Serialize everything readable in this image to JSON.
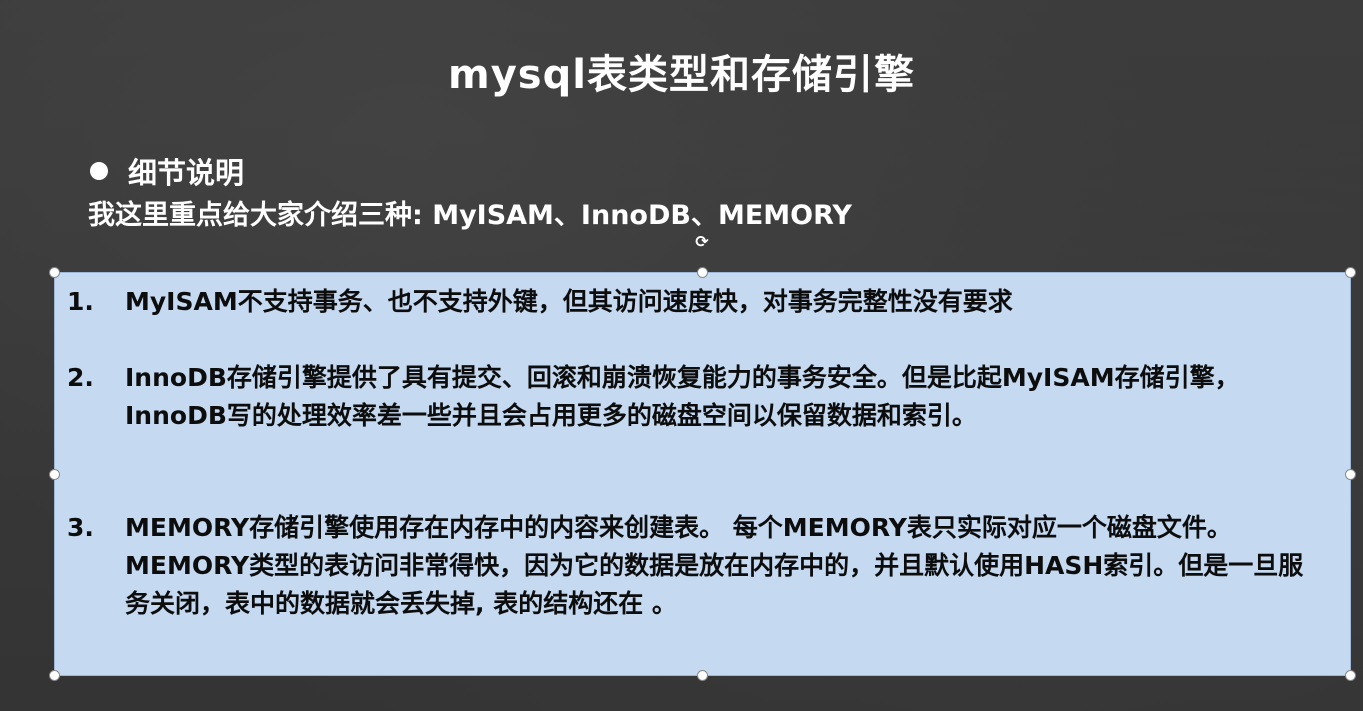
{
  "slide": {
    "title": "mysql表类型和存储引擎",
    "bullet_heading": "细节说明",
    "intro": "我这里重点给大家介绍三种: MyISAM、InnoDB、MEMORY"
  },
  "textbox": {
    "items": [
      {
        "number": "1.",
        "text": "MyISAM不支持事务、也不支持外键，但其访问速度快，对事务完整性没有要求"
      },
      {
        "number": "2.",
        "text": "InnoDB存储引擎提供了具有提交、回滚和崩溃恢复能力的事务安全。但是比起MyISAM存储引擎，InnoDB写的处理效率差一些并且会占用更多的磁盘空间以保留数据和索引。"
      },
      {
        "number": "3.",
        "text": "MEMORY存储引擎使用存在内存中的内容来创建表。 每个MEMORY表只实际对应一个磁盘文件。MEMORY类型的表访问非常得快，因为它的数据是放在内存中的，并且默认使用HASH索引。但是一旦服务关闭，表中的数据就会丢失掉, 表的结构还在 。"
      }
    ]
  },
  "icons": {
    "rotate_handle": "rotate-icon",
    "bullet": "bullet-dot-icon"
  },
  "colors": {
    "background": "#3a3a3a",
    "textbox_fill": "#c5d9f1",
    "title_text": "#ffffff",
    "body_text": "#0d0d0d"
  }
}
